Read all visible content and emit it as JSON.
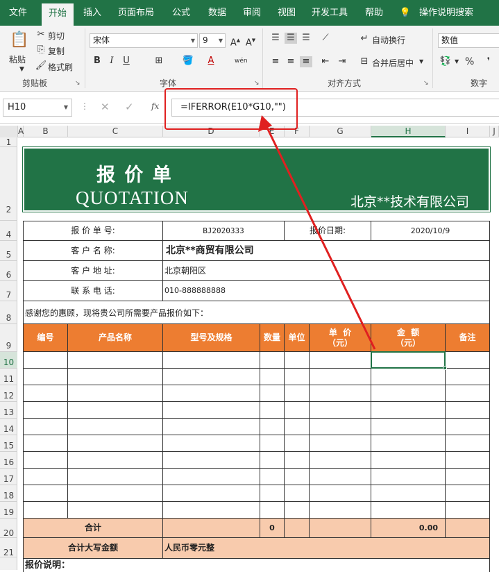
{
  "ribbon": {
    "tabs": [
      "文件",
      "开始",
      "插入",
      "页面布局",
      "公式",
      "数据",
      "审阅",
      "视图",
      "开发工具",
      "帮助",
      "操作说明搜索"
    ],
    "clipboard": {
      "paste": "粘贴",
      "cut": "剪切",
      "copy": "复制",
      "format_painter": "格式刷",
      "group": "剪贴板"
    },
    "font": {
      "name": "宋体",
      "size": "9",
      "group": "字体"
    },
    "alignment": {
      "wrap": "自动换行",
      "merge": "合并后居中",
      "group": "对齐方式"
    },
    "number": {
      "format": "数值",
      "percent": "%",
      "group": "数字"
    }
  },
  "formula_bar": {
    "name_box": "H10",
    "formula": "=IFERROR(E10*G10,\"\")"
  },
  "columns": [
    "A",
    "B",
    "C",
    "D",
    "E",
    "F",
    "G",
    "H",
    "I",
    "J"
  ],
  "rows": [
    "1",
    "2",
    "4",
    "5",
    "6",
    "7",
    "8",
    "9",
    "10",
    "11",
    "12",
    "13",
    "14",
    "15",
    "16",
    "17",
    "18",
    "19",
    "20",
    "21"
  ],
  "sheet": {
    "title_cn": "报 价 单",
    "title_en": "QUOTATION",
    "company": "北京**技术有限公司",
    "quote_no_label": "报 价 单 号:",
    "quote_no": "BJ2020333",
    "date_label": "报价日期:",
    "date": "2020/10/9",
    "customer_label": "客 户 名 称:",
    "customer": "北京**商贸有限公司",
    "address_label": "客 户 地 址:",
    "address": "北京朝阳区",
    "phone_label": "联 系 电 话:",
    "phone": "010-888888888",
    "intro": "感谢您的惠顾，现将贵公司所需要产品报价如下：",
    "headers": {
      "no": "编号",
      "product": "产品名称",
      "model": "型号及规格",
      "qty": "数量",
      "unit": "单位",
      "price_1": "单  价",
      "price_2": "（元）",
      "amount_1": "金  额",
      "amount_2": "（元）",
      "remark": "备注"
    },
    "total_label": "合计",
    "total_qty": "0",
    "total_amount": "0.00",
    "words_label": "合计大写金额",
    "words_value": "人民币零元整",
    "notes_label": "报价说明："
  },
  "colors": {
    "ribbon": "#217346",
    "title_bg": "#217346",
    "header_bg": "#ed7d31",
    "total_bg": "#f8cbad",
    "callout": "#e02020"
  }
}
